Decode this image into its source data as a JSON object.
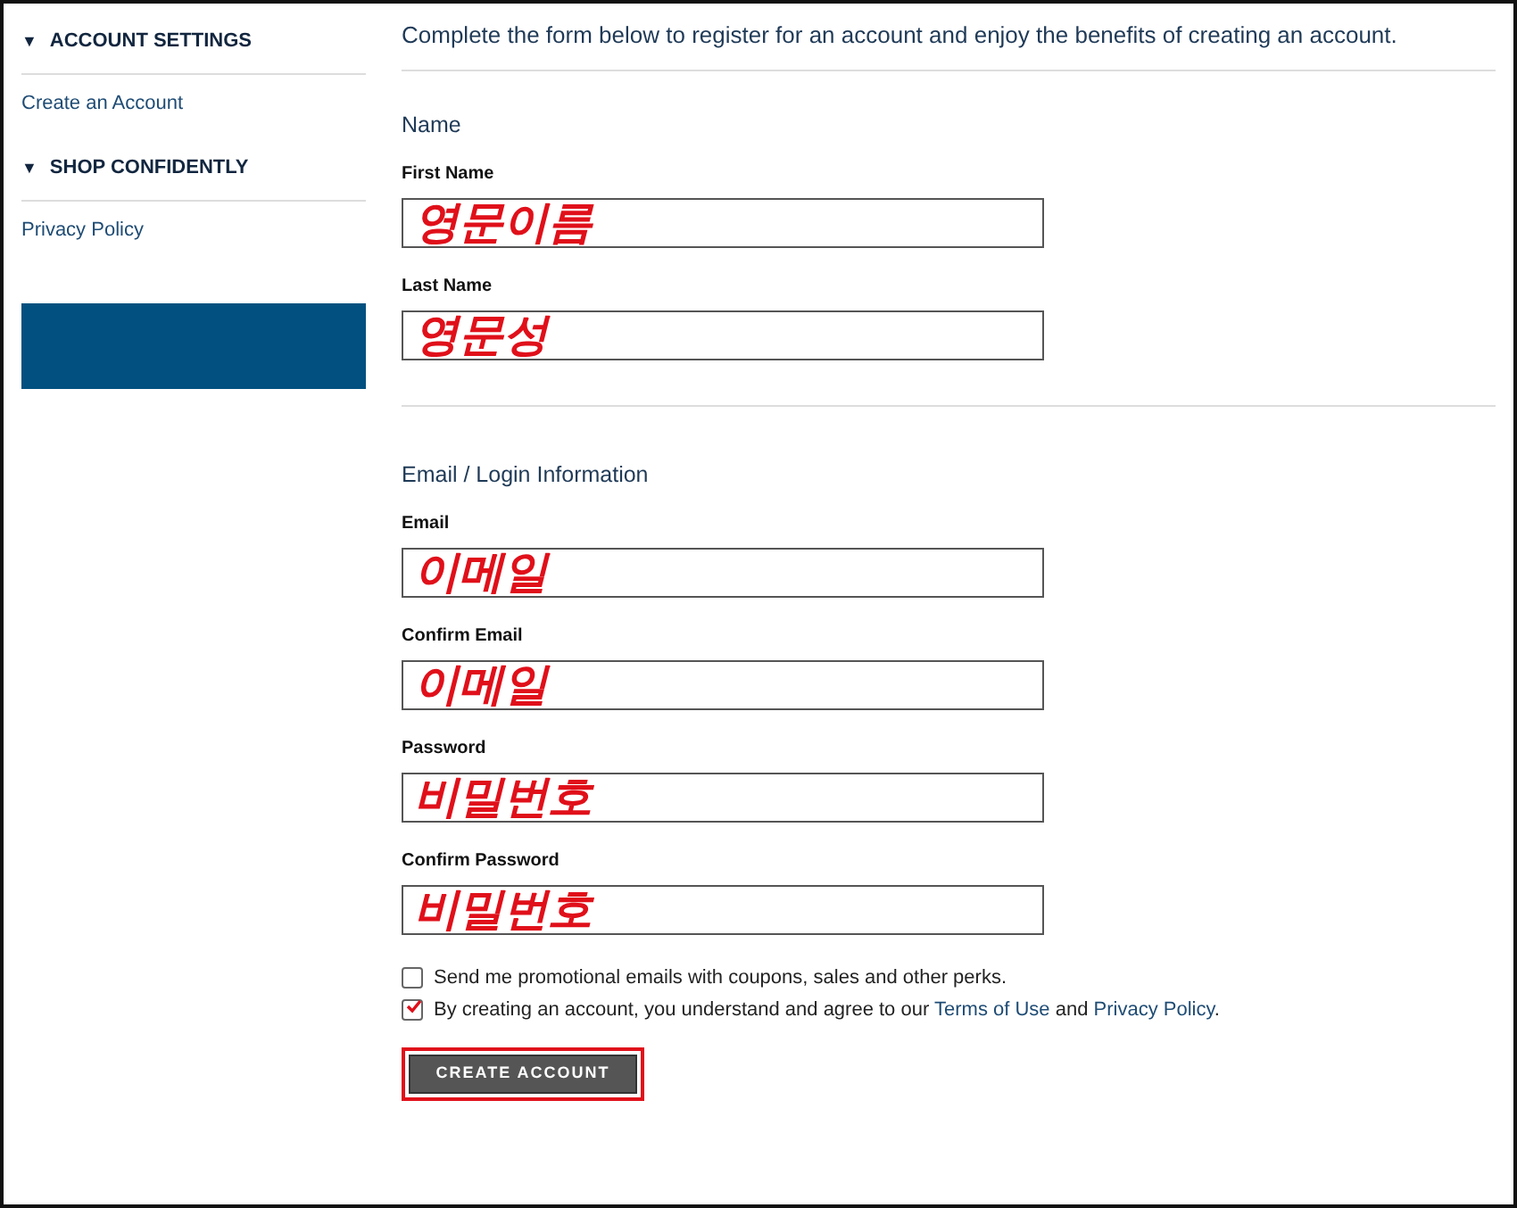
{
  "sidebar": {
    "groups": [
      {
        "marker": "▼",
        "title": "ACCOUNT SETTINGS",
        "items": [
          "Create an Account"
        ]
      },
      {
        "marker": "▼",
        "title": "SHOP CONFIDENTLY",
        "items": [
          "Privacy Policy"
        ]
      }
    ],
    "banner": {
      "kind": "blank"
    }
  },
  "intro": "Complete the form below to register for an account and enjoy the benefits of creating an account.",
  "sections": [
    {
      "title": "Name",
      "fields": [
        {
          "label": "First Name",
          "value": "영문이름"
        },
        {
          "label": "Last Name",
          "value": "영문성"
        }
      ]
    },
    {
      "title": "Email / Login Information",
      "fields": [
        {
          "label": "Email",
          "value": "이메일"
        },
        {
          "label": "Confirm Email",
          "value": "이메일"
        },
        {
          "label": "Password",
          "value": "비밀번호"
        },
        {
          "label": "Confirm Password",
          "value": "비밀번호"
        }
      ]
    }
  ],
  "options": [
    {
      "checked": false,
      "parts": [
        {
          "kind": "text",
          "text": "Send me promotional emails with coupons, sales and other perks."
        }
      ]
    },
    {
      "checked": true,
      "parts": [
        {
          "kind": "text",
          "text": "By creating an account, you understand and agree to our "
        },
        {
          "kind": "link",
          "text": "Terms of Use"
        },
        {
          "kind": "text",
          "text": " and "
        },
        {
          "kind": "link",
          "text": "Privacy Policy"
        },
        {
          "kind": "text",
          "text": "."
        }
      ]
    }
  ],
  "submit": {
    "label": "CREATE ACCOUNT",
    "highlighted": true
  }
}
